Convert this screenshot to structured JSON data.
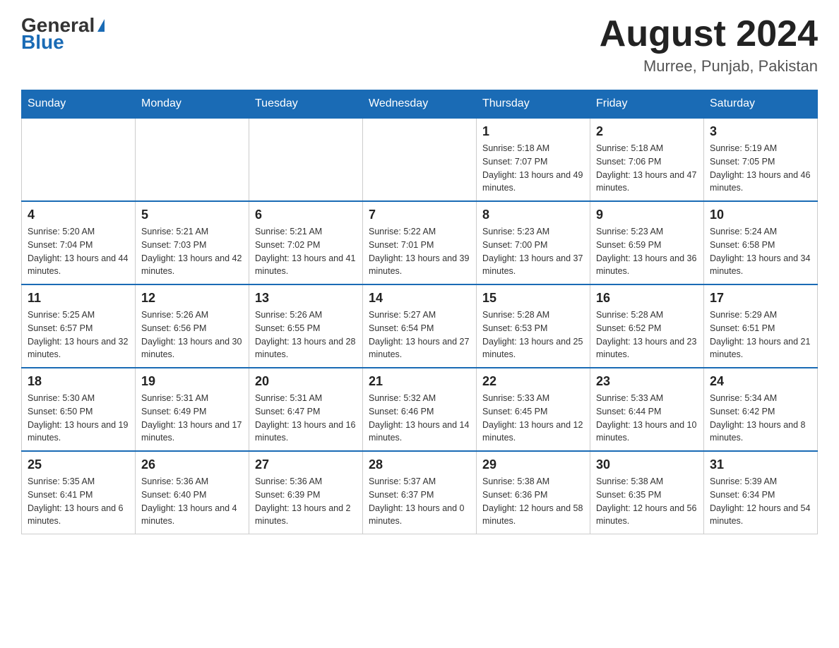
{
  "header": {
    "logo_general": "General",
    "logo_blue": "Blue",
    "month_title": "August 2024",
    "location": "Murree, Punjab, Pakistan"
  },
  "weekdays": [
    "Sunday",
    "Monday",
    "Tuesday",
    "Wednesday",
    "Thursday",
    "Friday",
    "Saturday"
  ],
  "weeks": [
    [
      {
        "day": "",
        "info": ""
      },
      {
        "day": "",
        "info": ""
      },
      {
        "day": "",
        "info": ""
      },
      {
        "day": "",
        "info": ""
      },
      {
        "day": "1",
        "info": "Sunrise: 5:18 AM\nSunset: 7:07 PM\nDaylight: 13 hours and 49 minutes."
      },
      {
        "day": "2",
        "info": "Sunrise: 5:18 AM\nSunset: 7:06 PM\nDaylight: 13 hours and 47 minutes."
      },
      {
        "day": "3",
        "info": "Sunrise: 5:19 AM\nSunset: 7:05 PM\nDaylight: 13 hours and 46 minutes."
      }
    ],
    [
      {
        "day": "4",
        "info": "Sunrise: 5:20 AM\nSunset: 7:04 PM\nDaylight: 13 hours and 44 minutes."
      },
      {
        "day": "5",
        "info": "Sunrise: 5:21 AM\nSunset: 7:03 PM\nDaylight: 13 hours and 42 minutes."
      },
      {
        "day": "6",
        "info": "Sunrise: 5:21 AM\nSunset: 7:02 PM\nDaylight: 13 hours and 41 minutes."
      },
      {
        "day": "7",
        "info": "Sunrise: 5:22 AM\nSunset: 7:01 PM\nDaylight: 13 hours and 39 minutes."
      },
      {
        "day": "8",
        "info": "Sunrise: 5:23 AM\nSunset: 7:00 PM\nDaylight: 13 hours and 37 minutes."
      },
      {
        "day": "9",
        "info": "Sunrise: 5:23 AM\nSunset: 6:59 PM\nDaylight: 13 hours and 36 minutes."
      },
      {
        "day": "10",
        "info": "Sunrise: 5:24 AM\nSunset: 6:58 PM\nDaylight: 13 hours and 34 minutes."
      }
    ],
    [
      {
        "day": "11",
        "info": "Sunrise: 5:25 AM\nSunset: 6:57 PM\nDaylight: 13 hours and 32 minutes."
      },
      {
        "day": "12",
        "info": "Sunrise: 5:26 AM\nSunset: 6:56 PM\nDaylight: 13 hours and 30 minutes."
      },
      {
        "day": "13",
        "info": "Sunrise: 5:26 AM\nSunset: 6:55 PM\nDaylight: 13 hours and 28 minutes."
      },
      {
        "day": "14",
        "info": "Sunrise: 5:27 AM\nSunset: 6:54 PM\nDaylight: 13 hours and 27 minutes."
      },
      {
        "day": "15",
        "info": "Sunrise: 5:28 AM\nSunset: 6:53 PM\nDaylight: 13 hours and 25 minutes."
      },
      {
        "day": "16",
        "info": "Sunrise: 5:28 AM\nSunset: 6:52 PM\nDaylight: 13 hours and 23 minutes."
      },
      {
        "day": "17",
        "info": "Sunrise: 5:29 AM\nSunset: 6:51 PM\nDaylight: 13 hours and 21 minutes."
      }
    ],
    [
      {
        "day": "18",
        "info": "Sunrise: 5:30 AM\nSunset: 6:50 PM\nDaylight: 13 hours and 19 minutes."
      },
      {
        "day": "19",
        "info": "Sunrise: 5:31 AM\nSunset: 6:49 PM\nDaylight: 13 hours and 17 minutes."
      },
      {
        "day": "20",
        "info": "Sunrise: 5:31 AM\nSunset: 6:47 PM\nDaylight: 13 hours and 16 minutes."
      },
      {
        "day": "21",
        "info": "Sunrise: 5:32 AM\nSunset: 6:46 PM\nDaylight: 13 hours and 14 minutes."
      },
      {
        "day": "22",
        "info": "Sunrise: 5:33 AM\nSunset: 6:45 PM\nDaylight: 13 hours and 12 minutes."
      },
      {
        "day": "23",
        "info": "Sunrise: 5:33 AM\nSunset: 6:44 PM\nDaylight: 13 hours and 10 minutes."
      },
      {
        "day": "24",
        "info": "Sunrise: 5:34 AM\nSunset: 6:42 PM\nDaylight: 13 hours and 8 minutes."
      }
    ],
    [
      {
        "day": "25",
        "info": "Sunrise: 5:35 AM\nSunset: 6:41 PM\nDaylight: 13 hours and 6 minutes."
      },
      {
        "day": "26",
        "info": "Sunrise: 5:36 AM\nSunset: 6:40 PM\nDaylight: 13 hours and 4 minutes."
      },
      {
        "day": "27",
        "info": "Sunrise: 5:36 AM\nSunset: 6:39 PM\nDaylight: 13 hours and 2 minutes."
      },
      {
        "day": "28",
        "info": "Sunrise: 5:37 AM\nSunset: 6:37 PM\nDaylight: 13 hours and 0 minutes."
      },
      {
        "day": "29",
        "info": "Sunrise: 5:38 AM\nSunset: 6:36 PM\nDaylight: 12 hours and 58 minutes."
      },
      {
        "day": "30",
        "info": "Sunrise: 5:38 AM\nSunset: 6:35 PM\nDaylight: 12 hours and 56 minutes."
      },
      {
        "day": "31",
        "info": "Sunrise: 5:39 AM\nSunset: 6:34 PM\nDaylight: 12 hours and 54 minutes."
      }
    ]
  ]
}
